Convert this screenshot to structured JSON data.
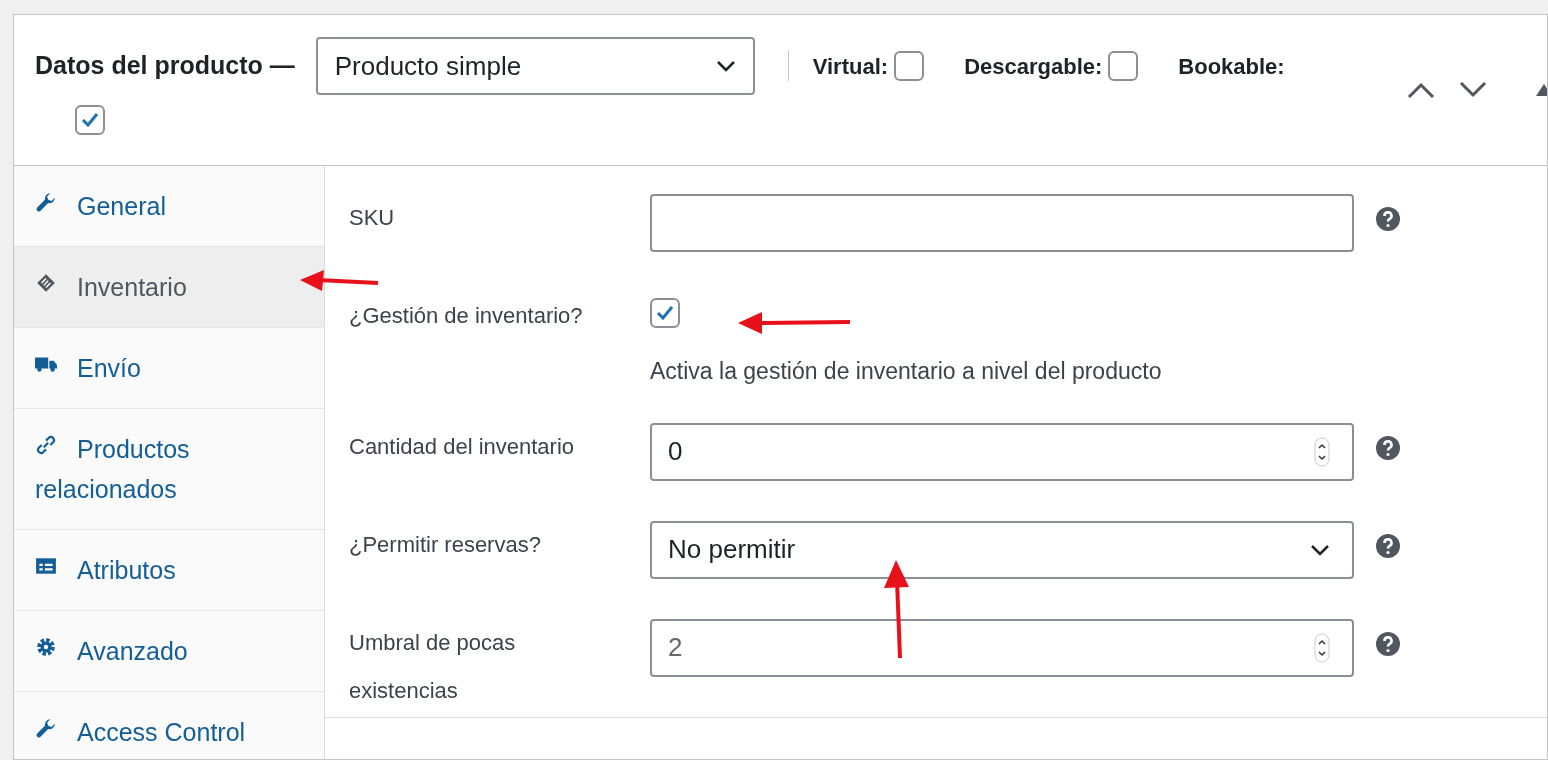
{
  "header": {
    "title": "Datos del producto —",
    "product_type": "Producto simple",
    "options": [
      {
        "label": "Virtual:",
        "checked": false
      },
      {
        "label": "Descargable:",
        "checked": false
      },
      {
        "label": "Bookable:",
        "checked": true
      }
    ]
  },
  "tabs": [
    {
      "label": "General",
      "kind": "general",
      "selected": false
    },
    {
      "label": "Inventario",
      "kind": "inventory",
      "selected": true
    },
    {
      "label": "Envío",
      "kind": "shipping",
      "selected": false
    },
    {
      "label": "Productos relacionados",
      "kind": "linked",
      "selected": false
    },
    {
      "label": "Atributos",
      "kind": "attributes",
      "selected": false
    },
    {
      "label": "Avanzado",
      "kind": "advanced",
      "selected": false
    },
    {
      "label": "Access Control",
      "kind": "access",
      "selected": false
    }
  ],
  "fields": [
    {
      "kind": "text",
      "label": "SKU",
      "help": true
    },
    {
      "kind": "checkbox",
      "label": "¿Gestión de inventario?",
      "checked": true,
      "description": "Activa la gestión de inventario a nivel del producto",
      "help": false
    },
    {
      "kind": "number",
      "label": "Cantidad del inventario",
      "value": "0",
      "help": true
    },
    {
      "kind": "select",
      "label": "¿Permitir reservas?",
      "value": "No permitir",
      "help": true
    },
    {
      "kind": "number",
      "label": "Umbral de pocas existencias",
      "placeholder": "2",
      "help": true
    }
  ]
}
